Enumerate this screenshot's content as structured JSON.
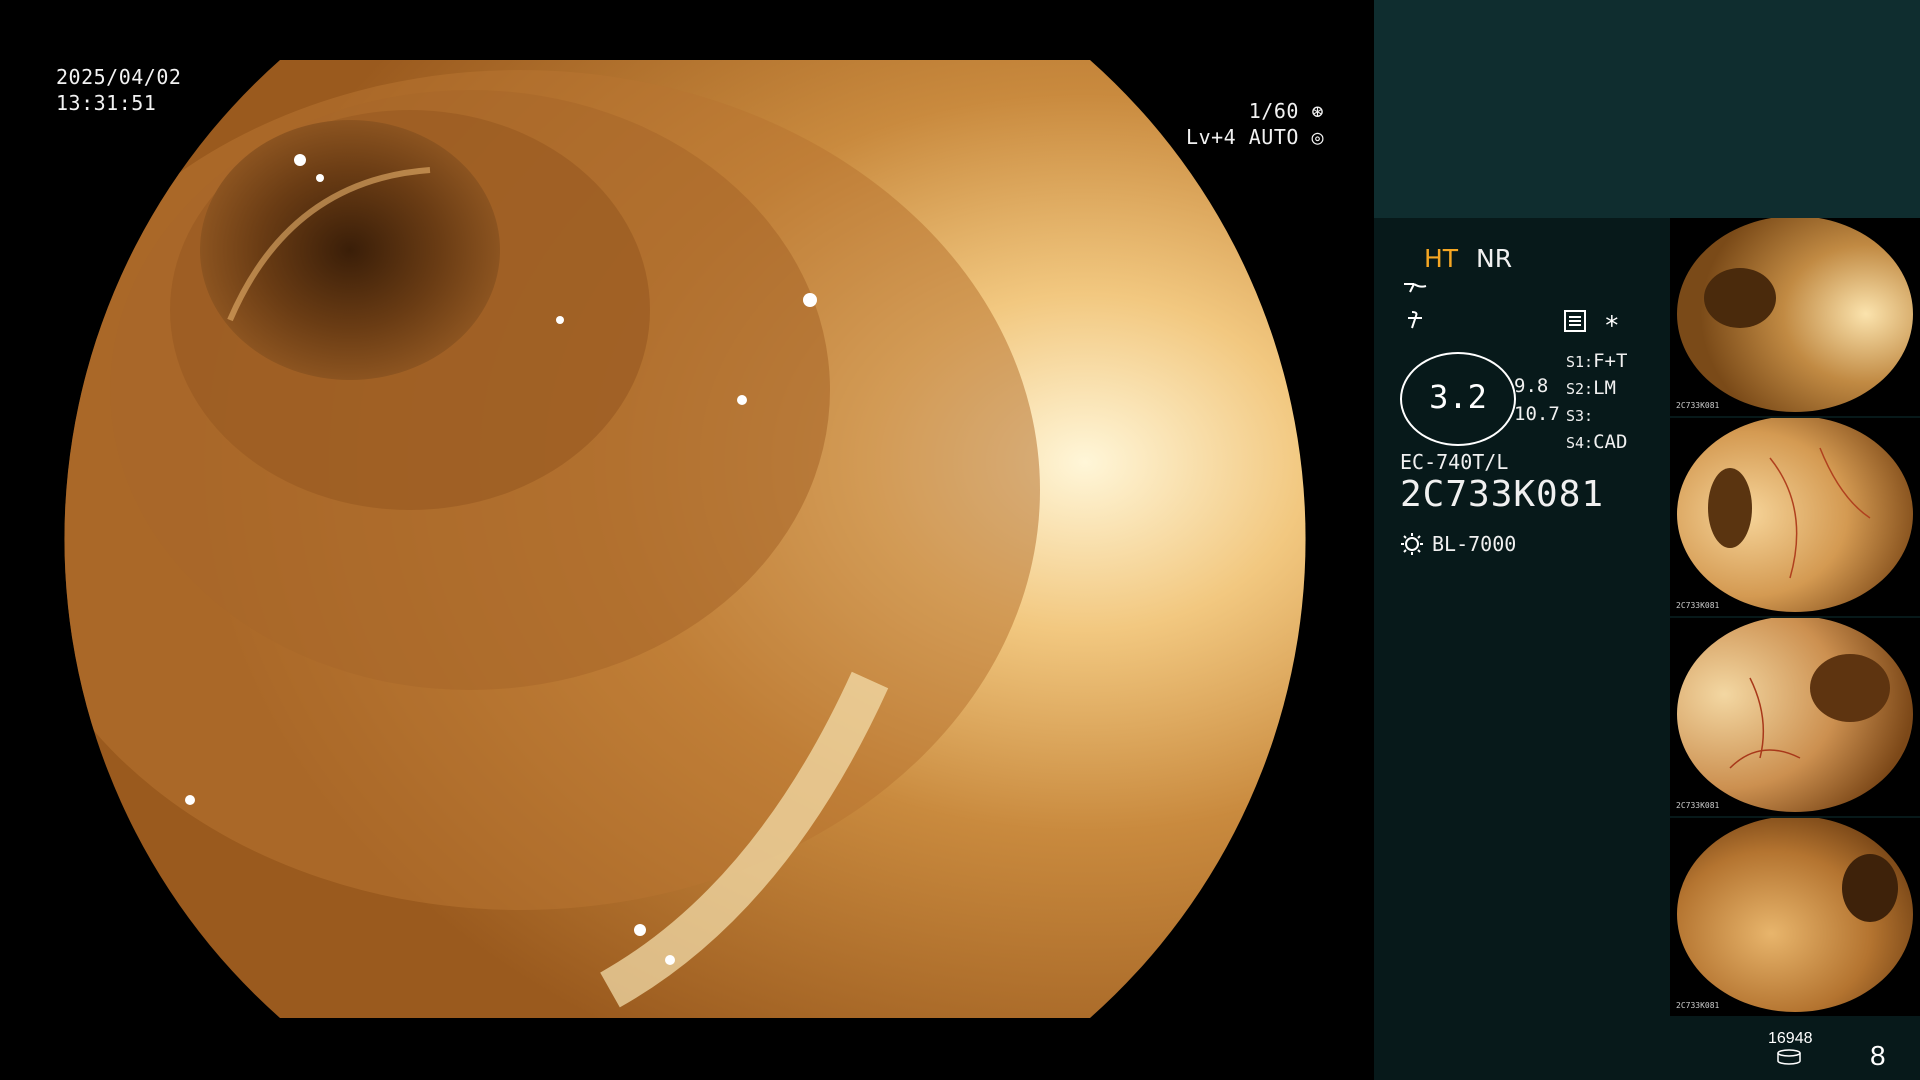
{
  "osd": {
    "date": "2025/04/02",
    "time": "13:31:51",
    "shutter": "1/60",
    "level": "Lv+4 AUTO"
  },
  "panel": {
    "mode_ht": "HT",
    "mode_nr": "NR",
    "zoom_main": "3.2",
    "zoom_a": "9.8",
    "zoom_b": "10.7",
    "scope_model": "EC-740T/L",
    "scope_serial": "2C733K081",
    "light_source": "BL-7000",
    "settings": [
      {
        "key": "S1:",
        "value": "F+T"
      },
      {
        "key": "S2:",
        "value": "LM"
      },
      {
        "key": "S3:",
        "value": ""
      },
      {
        "key": "S4:",
        "value": "CAD"
      }
    ],
    "thumbnail_caption": "2C733K081",
    "record_count": "16948",
    "page_number": "8"
  },
  "colors": {
    "panel_bg": "#07191a",
    "panel_top_bg": "#0f2d2f",
    "ht_accent": "#f5a623"
  },
  "icons": [
    "shutter-aperture-icon",
    "auto-iris-icon",
    "enhancement-icon",
    "structure-icon",
    "menu-list-icon",
    "asterisk-icon",
    "lamp-icon",
    "storage-disk-icon"
  ]
}
